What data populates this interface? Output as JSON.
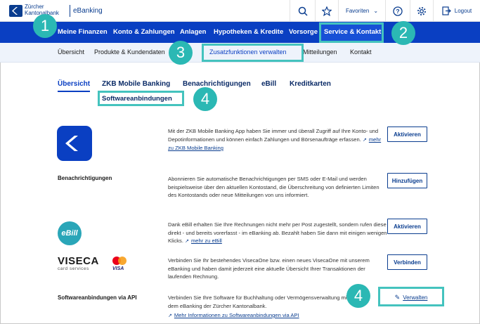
{
  "header": {
    "bank_name_line1": "Zürcher",
    "bank_name_line2": "Kantonalbank",
    "product": "eBanking",
    "favorites": "Favoriten",
    "logout": "Logout"
  },
  "main_nav": {
    "items": [
      "Meine Finanzen",
      "Konto & Zahlungen",
      "Anlagen",
      "Hypotheken & Kredite",
      "Vorsorge",
      "Service & Kontakt"
    ],
    "active": "Service & Kontakt"
  },
  "sub_nav": {
    "items": [
      "Übersicht",
      "Produkte & Kundendaten",
      "Zusatzfunktionen verwalten",
      "Mitteilungen",
      "Kontakt"
    ],
    "active": "Zusatzfunktionen verwalten"
  },
  "tabs": {
    "items": [
      "Übersicht",
      "ZKB Mobile Banking",
      "Benachrichtigungen",
      "eBill",
      "Kreditkarten"
    ],
    "second_row": "Softwareanbindungen",
    "active": "Übersicht"
  },
  "rows": [
    {
      "label": "",
      "desc": "Mit der ZKB Mobile Banking App haben Sie immer und überall Zugriff auf Ihre Konto- und Depotinformationen und können einfach Zahlungen und Börsenaufträge erfassen.",
      "link": "mehr zu ZKB Mobile Banking",
      "button": "Aktivieren"
    },
    {
      "label": "Benachrichtigungen",
      "desc": "Abonnieren Sie automatische Benachrichtigungen per SMS oder E-Mail und werden beispielsweise über den aktuellen Kontostand, die Überschreitung von definierten Limiten des Kontostands oder neue Mitteilungen von uns informiert.",
      "link": "",
      "button": "Hinzufügen"
    },
    {
      "label": "",
      "desc": "Dank eBill erhalten Sie Ihre Rechnungen nicht mehr per Post zugestellt, sondern rufen diese direkt - und bereits vorerfasst - im eBanking ab. Bezahlt haben Sie dann mit einigen wenigen Klicks.",
      "link": "mehr zu eBill",
      "button": "Aktivieren"
    },
    {
      "label": "",
      "desc": "Verbinden Sie Ihr bestehendes VisecaOne bzw. einen neues VisecaOne mit unserem eBanking und haben damit jederzeit eine aktuelle Übersicht Ihrer Transaktionen der laufenden Rechnung.",
      "link": "",
      "button": "Verbinden"
    },
    {
      "label": "Softwareanbindungen via API",
      "desc": "Verbinden Sie Ihre Software für Buchhaltung oder Vermögensverwaltung mit dem eBanking der Zürcher Kantonalbank.",
      "link": "Mehr Informationen zu Softwareanbindungen via API",
      "button": "Verwalten"
    }
  ],
  "logos": {
    "ebill": "eBill",
    "viseca": "VISECA",
    "viseca_sub": "card services",
    "visa": "VISA"
  },
  "annotations": [
    "1",
    "2",
    "3",
    "4",
    "4"
  ],
  "colors": {
    "primary_blue": "#0a3fc2",
    "active_blue": "#1750d6",
    "annotation_teal": "#2bb8b4",
    "ebill_teal": "#2aa6b8"
  }
}
